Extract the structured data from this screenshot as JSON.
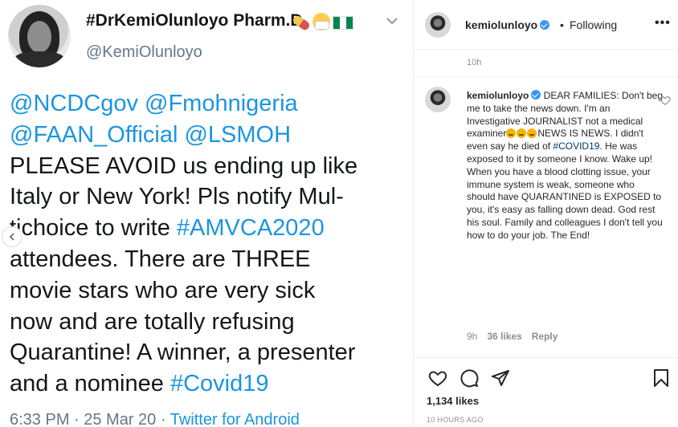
{
  "tweet": {
    "display_name": "#DrKemiOlunloyo Pharm.D",
    "handle": "@KemiOlunloyo",
    "body_lines": [
      [
        {
          "t": "@NCDCgov",
          "c": "mention"
        },
        {
          "t": " "
        },
        {
          "t": "@Fmohnigeria",
          "c": "mention"
        }
      ],
      [
        {
          "t": "@FAAN_Official",
          "c": "mention"
        },
        {
          "t": " "
        },
        {
          "t": "@LSMOH",
          "c": "mention"
        }
      ],
      [
        {
          "t": "PLEASE AVOID us ending up like"
        }
      ],
      [
        {
          "t": "Italy or New York! Pls notify Mul-"
        }
      ],
      [
        {
          "t": "tichoice to write "
        },
        {
          "t": "#AMVCA2020",
          "c": "tag"
        }
      ],
      [
        {
          "t": "attendees. There are THREE"
        }
      ],
      [
        {
          "t": "movie stars who are very sick"
        }
      ],
      [
        {
          "t": "now and are totally refusing"
        }
      ],
      [
        {
          "t": "Quarantine! A winner, a presenter"
        }
      ],
      [
        {
          "t": "and a nominee "
        },
        {
          "t": "#Covid19",
          "c": "tag"
        }
      ]
    ],
    "meta_time": "6:33 PM · 25 Mar 20 · ",
    "meta_source": "Twitter for Android",
    "badges": [
      "pill-icon",
      "mask-face-icon",
      "nigeria-flag-icon"
    ]
  },
  "instagram": {
    "username": "kemiolunloyo",
    "separator": "•",
    "following_label": "Following",
    "more_label": "•••",
    "post_time": "10h",
    "caption_user": "kemiolunloyo",
    "caption_parts": [
      {
        "t": " DEAR FAMILIES: Don't beg me to take the news down. I'm an Investigative JOURNALIST not a medical examiner"
      },
      {
        "e": "angry-face-emoji"
      },
      {
        "e": "angry-face-emoji"
      },
      {
        "e": "angry-face-emoji"
      },
      {
        "t": "NEWS IS NEWS. I didn't even say he died of "
      },
      {
        "t": "#COVID19",
        "c": "tag"
      },
      {
        "t": ". He was exposed to it by someone I know. Wake up! When you have a blood clotting issue, your immune system is weak, someone who should have QUARANTINED is EXPOSED to you, it's easy as falling down dead. God rest his soul. Family and colleagues I don't tell you how to do your job. The End!"
      }
    ],
    "comment_time": "9h",
    "comment_likes": "36 likes",
    "reply_label": "Reply",
    "likes_count": "1,134 likes",
    "time_ago": "10 HOURS AGO",
    "colors": {
      "link": "#1b95e0",
      "ig_text": "#262626",
      "ig_muted": "#8e8e8e",
      "verified": "#3897f0"
    }
  }
}
